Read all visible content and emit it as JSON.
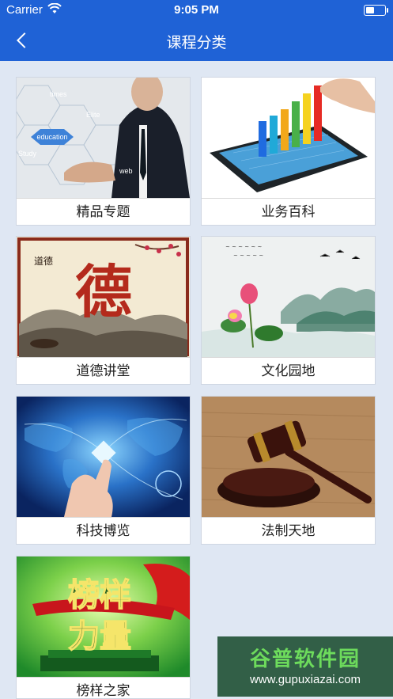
{
  "status_bar": {
    "carrier": "Carrier",
    "time": "9:05 PM"
  },
  "nav": {
    "title": "课程分类"
  },
  "categories": [
    {
      "label": "精品专题",
      "image_icon": "business-education-icon",
      "tags": [
        "times",
        "Elite",
        "education",
        "Study",
        "web"
      ]
    },
    {
      "label": "业务百科",
      "image_icon": "tablet-chart-icon"
    },
    {
      "label": "道德讲堂",
      "image_icon": "morality-calligraphy-icon",
      "calligraphy": "德",
      "small_text": "道德"
    },
    {
      "label": "文化园地",
      "image_icon": "lotus-landscape-icon"
    },
    {
      "label": "科技博览",
      "image_icon": "tech-world-map-icon"
    },
    {
      "label": "法制天地",
      "image_icon": "gavel-icon"
    },
    {
      "label": "榜样之家",
      "image_icon": "role-model-icon",
      "headline_top": "榜样",
      "headline_bottom": "力量"
    }
  ],
  "watermark": {
    "title": "谷普软件园",
    "url": "www.gupuxiazai.com"
  },
  "colors": {
    "nav_blue": "#1f62d6",
    "background": "#dfe7f3"
  }
}
